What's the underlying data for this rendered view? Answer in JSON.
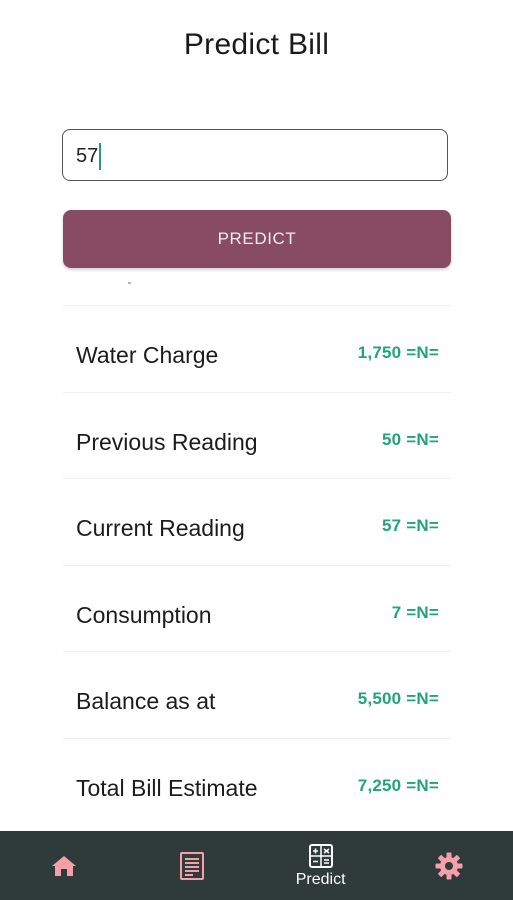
{
  "header": {
    "title": "Predict Bill"
  },
  "input": {
    "value": "57",
    "placeholder": ""
  },
  "predict_button": {
    "label": "PREDICT"
  },
  "results": [
    {
      "label": "Water Charge",
      "value": "1,750 =N="
    },
    {
      "label": "Previous Reading",
      "value": "50 =N="
    },
    {
      "label": "Current Reading",
      "value": "57 =N="
    },
    {
      "label": "Consumption",
      "value": "7 =N="
    },
    {
      "label": "Balance as at",
      "value": "5,500 =N="
    },
    {
      "label": "Total Bill Estimate",
      "value": "7,250 =N="
    }
  ],
  "bottom_nav": {
    "items": [
      {
        "icon": "home-icon",
        "label": ""
      },
      {
        "icon": "bill-document-icon",
        "label": ""
      },
      {
        "icon": "calculator-icon",
        "label": "Predict",
        "active": true
      },
      {
        "icon": "gear-icon",
        "label": ""
      }
    ]
  },
  "colors": {
    "accent": "#874b62",
    "value_green": "#21a47a",
    "nav_background": "#2f3a3a",
    "nav_icon_pink": "#f3a0a8",
    "nav_icon_active": "#ffffff"
  }
}
